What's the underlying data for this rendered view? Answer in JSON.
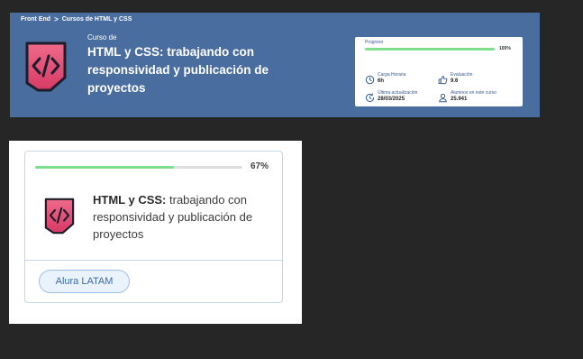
{
  "breadcrumb": {
    "items": [
      "Front End",
      "Cursos de HTML y CSS"
    ],
    "separator": ">"
  },
  "course_header": {
    "pre_title": "Curso de",
    "title": "HTML y CSS: trabajando con responsividad y publicación de proyectos",
    "logo_icon": "code-brackets-icon"
  },
  "stats": {
    "progress_label": "Progreso",
    "progress_fraction": 1.0,
    "progress_text": "100%",
    "items": [
      {
        "icon": "clock-icon",
        "label": "Carga Horaria",
        "value": "6h"
      },
      {
        "icon": "thumbs-up-icon",
        "label": "Evaluación",
        "value": "9.6"
      },
      {
        "icon": "refresh-clock-icon",
        "label": "Última actualización",
        "value": "28/03/2025"
      },
      {
        "icon": "user-icon",
        "label": "Alumnos en este curso",
        "value": "25.941"
      }
    ]
  },
  "course_card": {
    "progress_fraction": 0.67,
    "progress_text": "67%",
    "title_bold": "HTML y CSS:",
    "title_rest": " trabajando con responsividad y publicación de proyectos",
    "logo_icon": "code-brackets-icon",
    "tag_label": "Alura LATAM"
  },
  "colors": {
    "banner_bg": "#4a6d9f",
    "progress_fill": "#7ee08d",
    "logo_pink": "#e94e7a",
    "tag_bg": "#eaf3fc",
    "tag_text": "#3b6aa8"
  }
}
